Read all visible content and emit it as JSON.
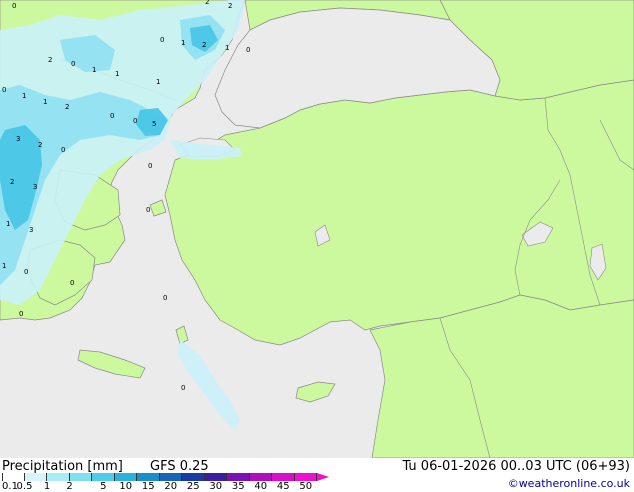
{
  "legend": {
    "title": "Precipitation [mm]",
    "model": "GFS 0.25",
    "datetime": "Tu 06-01-2026 00..03 UTC (06+93)",
    "credit": "©weatheronline.co.uk",
    "scale": [
      {
        "label": "0.1",
        "color": "#ffffff"
      },
      {
        "label": "0.5",
        "color": "#d4f5fb"
      },
      {
        "label": "1",
        "color": "#a8ecf6"
      },
      {
        "label": "2",
        "color": "#7fe0f0"
      },
      {
        "label": "5",
        "color": "#4dcde8"
      },
      {
        "label": "10",
        "color": "#2ab2dc"
      },
      {
        "label": "15",
        "color": "#1a8ecb"
      },
      {
        "label": "20",
        "color": "#1a64b8"
      },
      {
        "label": "25",
        "color": "#1c3aa6"
      },
      {
        "label": "30",
        "color": "#3b1ea2"
      },
      {
        "label": "35",
        "color": "#7a14b4"
      },
      {
        "label": "40",
        "color": "#b00fbe"
      },
      {
        "label": "45",
        "color": "#d80fc8"
      },
      {
        "label": "50",
        "color": "#f00fd0"
      }
    ]
  },
  "map_values": [
    "0",
    "2",
    "2",
    "0",
    "1",
    "2",
    "1",
    "0",
    "2",
    "0",
    "1",
    "1",
    "1",
    "0",
    "1",
    "1",
    "2",
    "0",
    "0",
    "5",
    "3",
    "2",
    "0",
    "2",
    "3",
    "0",
    "1",
    "3",
    "0",
    "1",
    "0",
    "0",
    "0",
    "0",
    "0"
  ],
  "colors": {
    "sea": "#ebebeb",
    "land": "#ccf99e",
    "border": "#8a8a8a",
    "precip_light": "#c9f1fa",
    "precip_mid": "#8ee0f2",
    "precip_heavy": "#49c6e6"
  }
}
